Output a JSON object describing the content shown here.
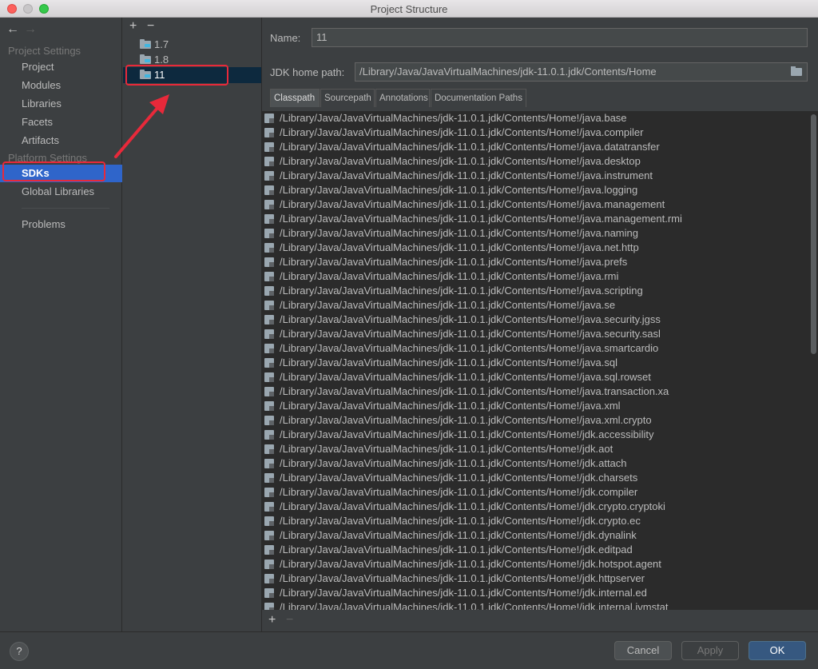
{
  "window": {
    "title": "Project Structure"
  },
  "sidebar": {
    "project_settings_header": "Project Settings",
    "project_settings_items": [
      "Project",
      "Modules",
      "Libraries",
      "Facets",
      "Artifacts"
    ],
    "platform_settings_header": "Platform Settings",
    "platform_settings_items": [
      "SDKs",
      "Global Libraries"
    ],
    "problems_label": "Problems",
    "selected": "SDKs"
  },
  "sdk_list": {
    "items": [
      "1.7",
      "1.8",
      "11"
    ],
    "selected": "11"
  },
  "detail": {
    "name_label": "Name:",
    "name_value": "11",
    "jdk_home_label": "JDK home path:",
    "jdk_home_value": "/Library/Java/JavaVirtualMachines/jdk-11.0.1.jdk/Contents/Home",
    "tabs": [
      "Classpath",
      "Sourcepath",
      "Annotations",
      "Documentation Paths"
    ],
    "active_tab": "Classpath",
    "classpath_prefix": "/Library/Java/JavaVirtualMachines/jdk-11.0.1.jdk/Contents/Home!/",
    "classpath_entries": [
      "java.base",
      "java.compiler",
      "java.datatransfer",
      "java.desktop",
      "java.instrument",
      "java.logging",
      "java.management",
      "java.management.rmi",
      "java.naming",
      "java.net.http",
      "java.prefs",
      "java.rmi",
      "java.scripting",
      "java.se",
      "java.security.jgss",
      "java.security.sasl",
      "java.smartcardio",
      "java.sql",
      "java.sql.rowset",
      "java.transaction.xa",
      "java.xml",
      "java.xml.crypto",
      "jdk.accessibility",
      "jdk.aot",
      "jdk.attach",
      "jdk.charsets",
      "jdk.compiler",
      "jdk.crypto.cryptoki",
      "jdk.crypto.ec",
      "jdk.dynalink",
      "jdk.editpad",
      "jdk.hotspot.agent",
      "jdk.httpserver",
      "jdk.internal.ed",
      "jdk.internal.jvmstat"
    ]
  },
  "buttons": {
    "help": "?",
    "cancel": "Cancel",
    "apply": "Apply",
    "ok": "OK"
  },
  "colors": {
    "selection": "#2f65ca",
    "annotation": "#e8293a",
    "ok_button": "#365880"
  },
  "icons": {
    "back": "arrow-left-icon",
    "forward": "arrow-right-icon",
    "add": "plus-icon",
    "remove": "minus-icon"
  }
}
